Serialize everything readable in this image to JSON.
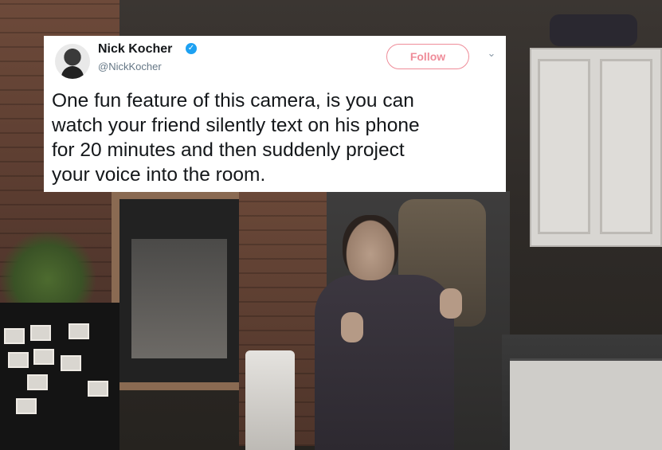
{
  "tweet": {
    "author_name": "Nick Kocher",
    "author_handle": "@NickKocher",
    "verified_icon": "verified-badge-icon",
    "follow_label": "Follow",
    "menu_icon": "chevron-down-icon",
    "text": "One fun feature of this camera, is you can\nwatch your friend silently text on his phone\nfor 20 minutes and then suddenly project\nyour voice into the room.",
    "colors": {
      "follow": "#ef8c99",
      "verified": "#1da1f2",
      "handle": "#657786"
    }
  }
}
